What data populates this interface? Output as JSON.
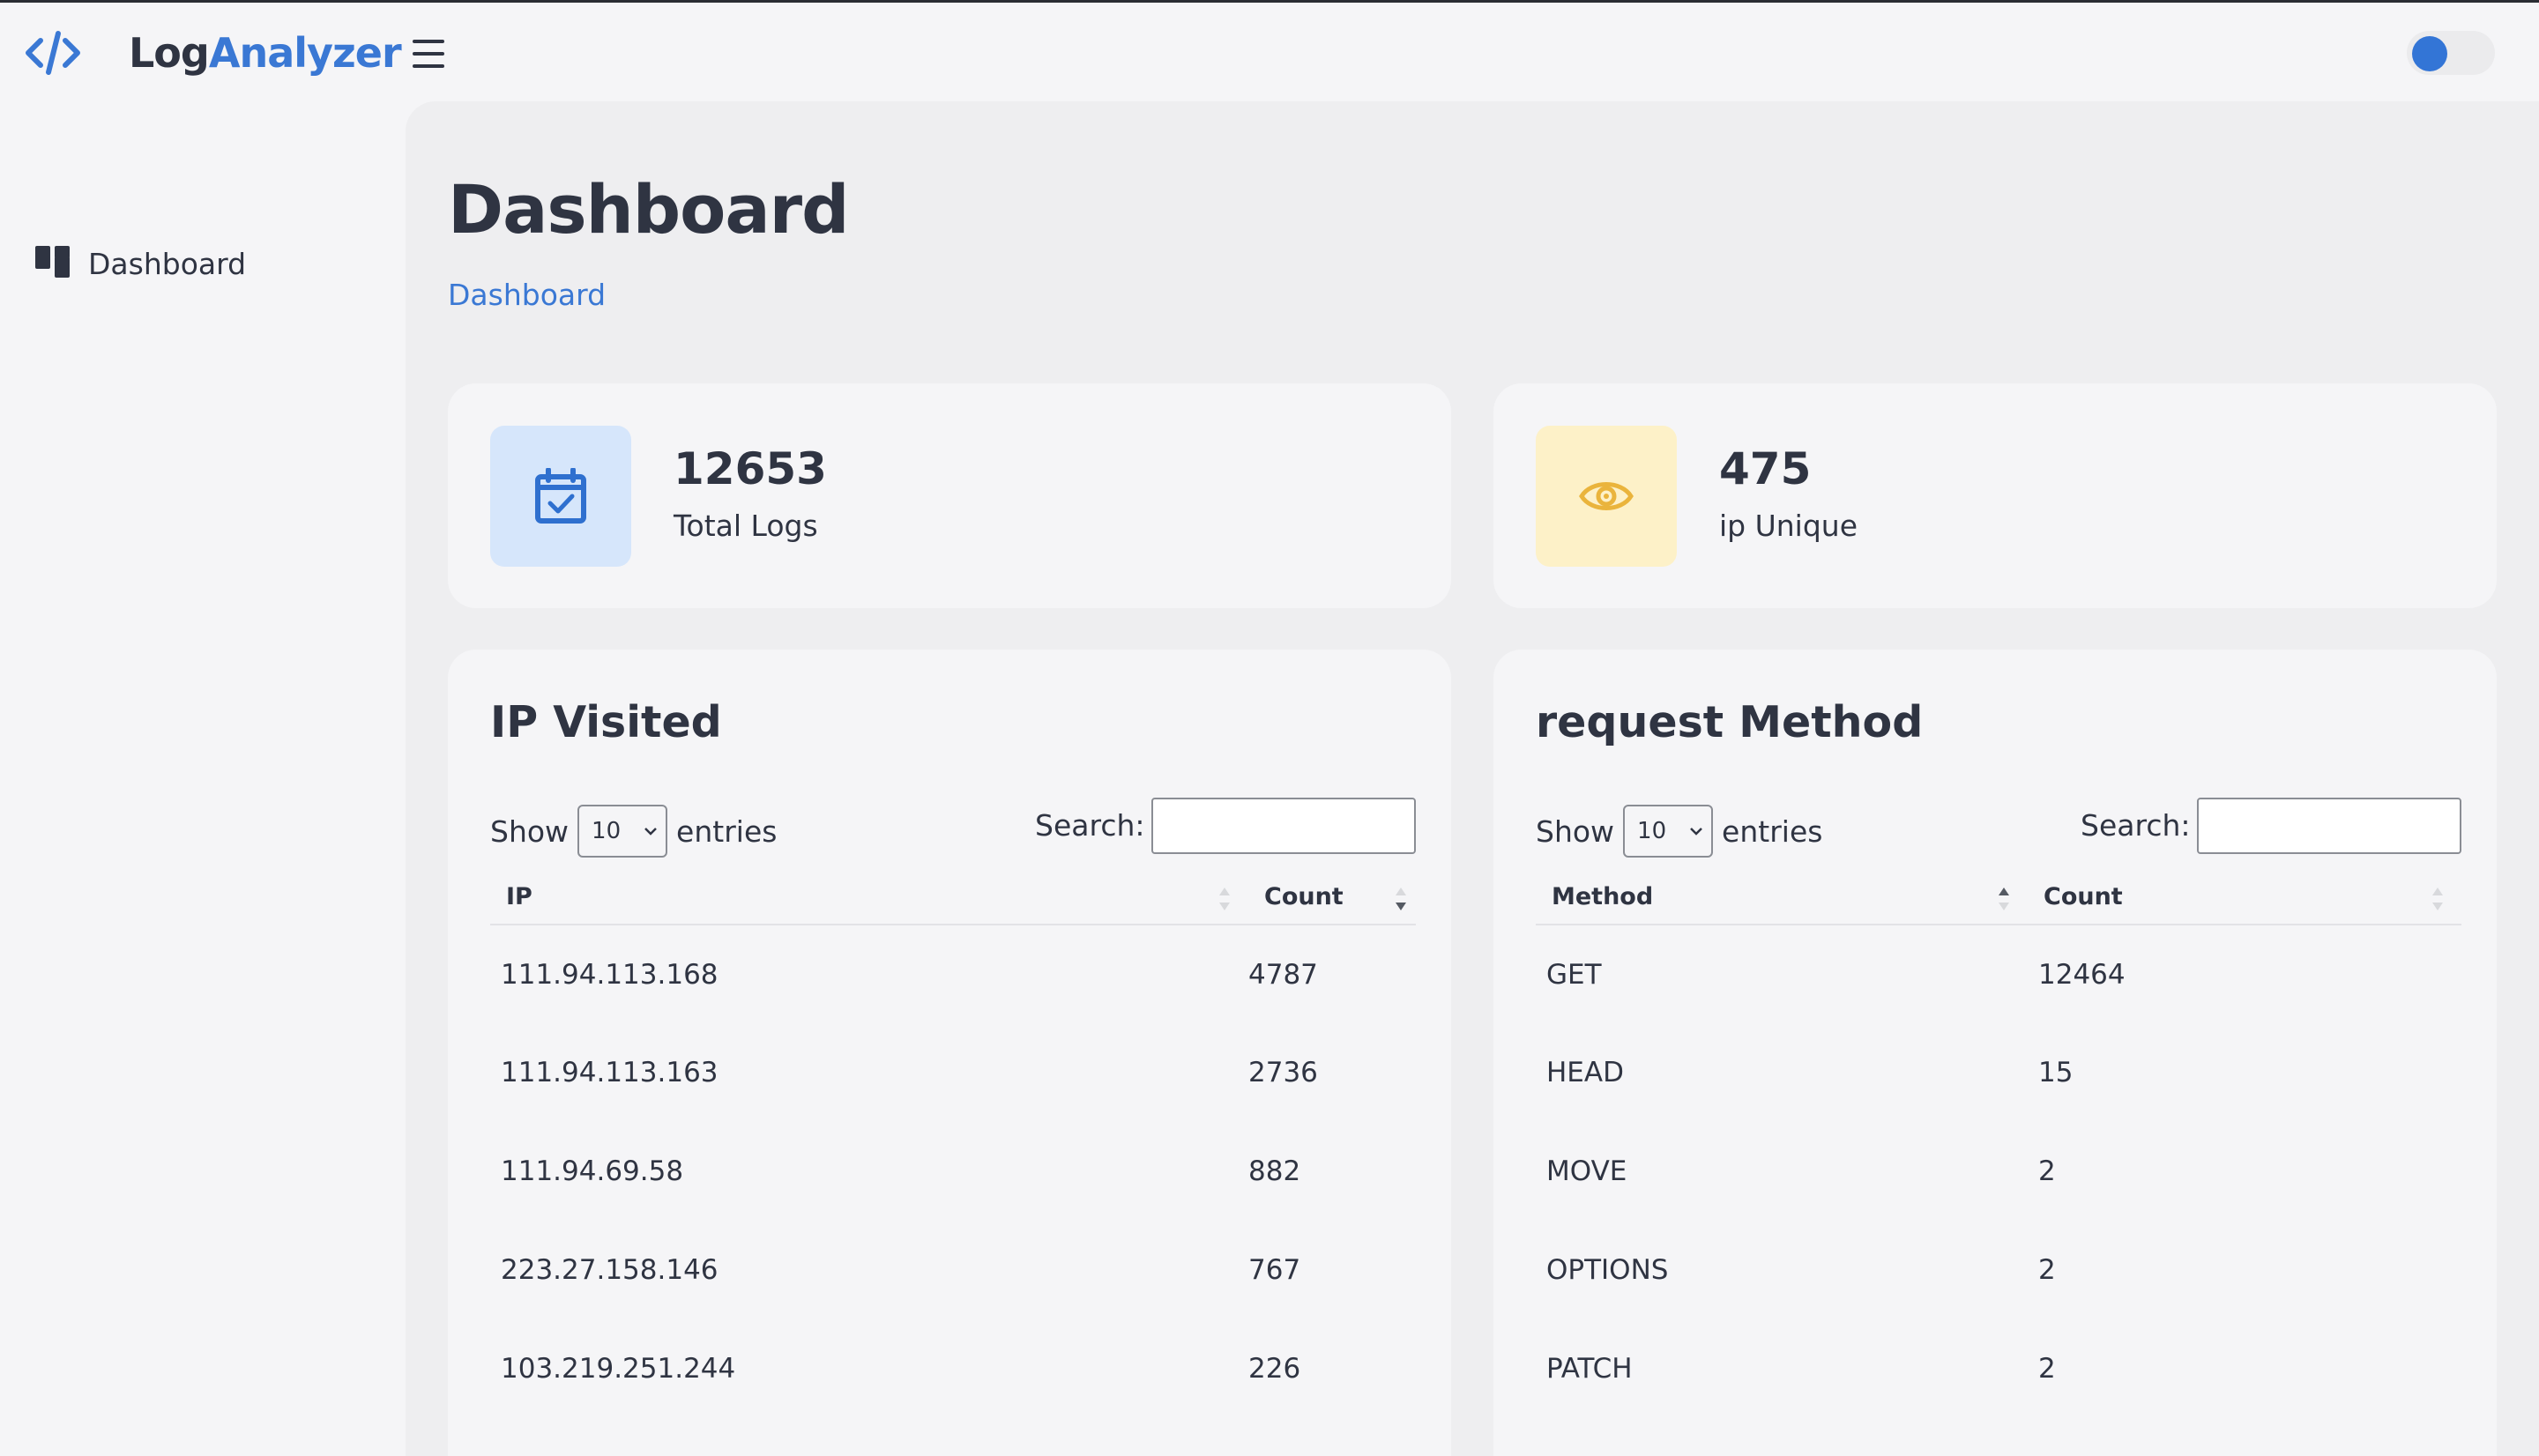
{
  "app": {
    "brand_part1": "Log",
    "brand_part2": "Analyzer"
  },
  "sidebar": {
    "items": [
      {
        "label": "Dashboard",
        "icon": "dashboard-grid-icon"
      }
    ]
  },
  "page": {
    "title": "Dashboard",
    "breadcrumb": "Dashboard"
  },
  "stats": [
    {
      "value": "12653",
      "label": "Total Logs",
      "icon": "calendar-check-icon",
      "icon_bg": "#d6e6fb",
      "icon_color": "#2f70cf"
    },
    {
      "value": "475",
      "label": "ip Unique",
      "icon": "eye-icon",
      "icon_bg": "#fdf1c8",
      "icon_color": "#eab43c"
    }
  ],
  "ip_table": {
    "title": "IP Visited",
    "show_label": "Show",
    "entries_label": "entries",
    "length_value": "10",
    "search_label": "Search:",
    "search_value": "",
    "columns": [
      "IP",
      "Count"
    ],
    "rows": [
      [
        "111.94.113.168",
        "4787"
      ],
      [
        "111.94.113.163",
        "2736"
      ],
      [
        "111.94.69.58",
        "882"
      ],
      [
        "223.27.158.146",
        "767"
      ],
      [
        "103.219.251.244",
        "226"
      ]
    ]
  },
  "method_table": {
    "title": "request Method",
    "show_label": "Show",
    "entries_label": "entries",
    "length_value": "10",
    "search_label": "Search:",
    "search_value": "",
    "columns": [
      "Method",
      "Count"
    ],
    "rows": [
      [
        "GET",
        "12464"
      ],
      [
        "HEAD",
        "15"
      ],
      [
        "MOVE",
        "2"
      ],
      [
        "OPTIONS",
        "2"
      ],
      [
        "PATCH",
        "2"
      ]
    ]
  },
  "colors": {
    "accent": "#3a78d4",
    "text": "#2f3442",
    "main_bg": "#eeeef0",
    "card_bg": "#f5f5f7"
  }
}
